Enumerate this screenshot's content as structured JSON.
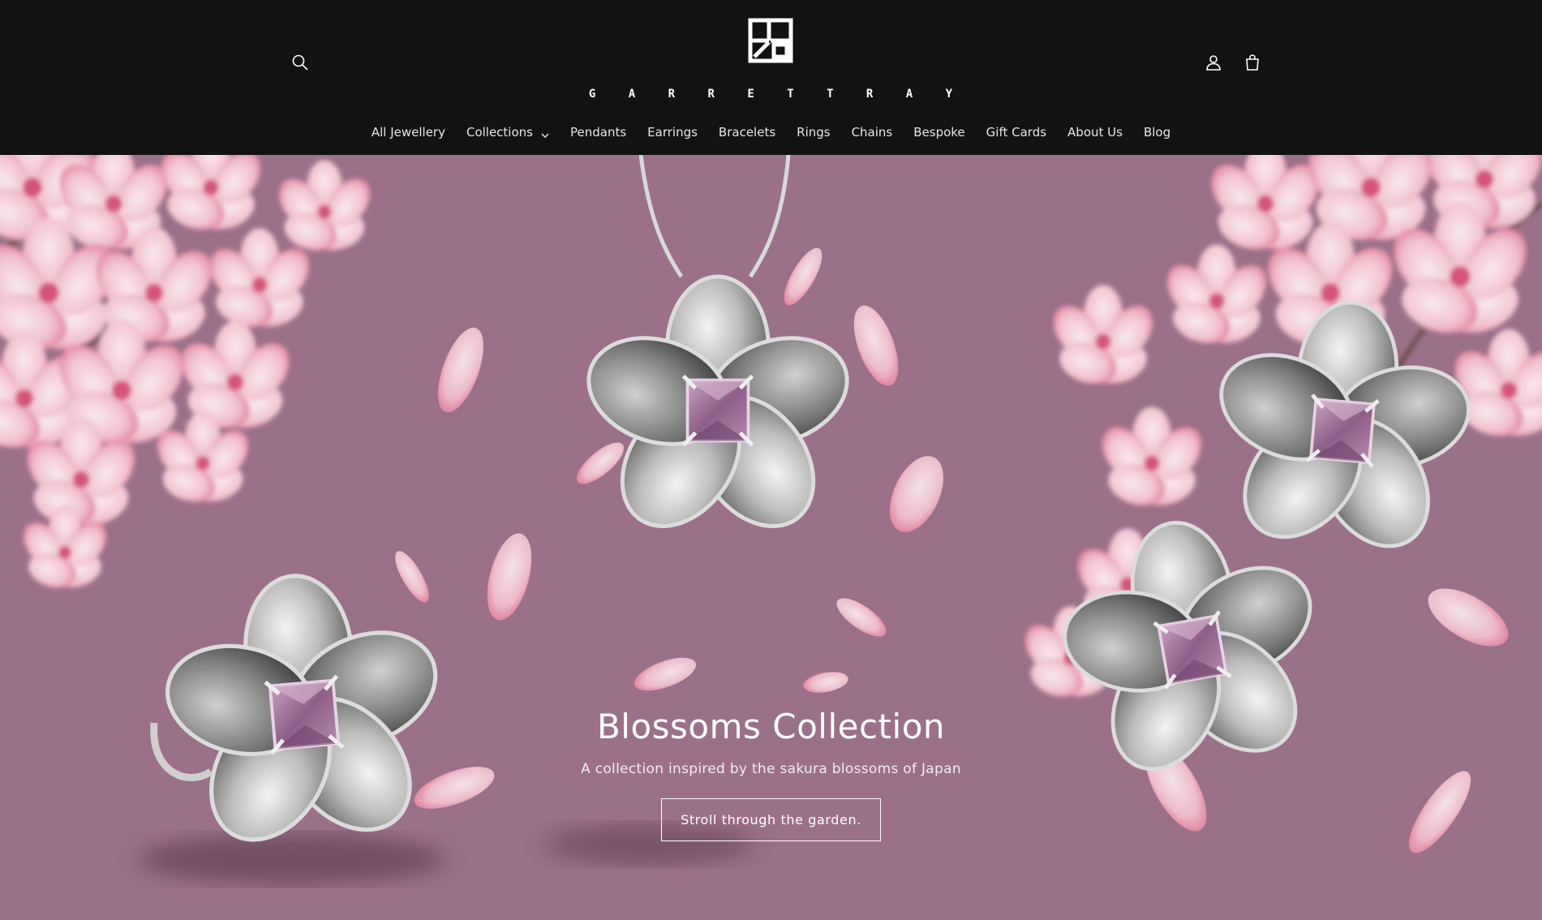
{
  "header": {
    "logo_text": "G A R R E T T   R A Y",
    "icons": {
      "search": "search-icon",
      "account": "user-icon",
      "cart": "cart-icon"
    }
  },
  "nav": {
    "items": [
      {
        "label": "All Jewellery"
      },
      {
        "label": "Collections",
        "has_dropdown": true
      },
      {
        "label": "Pendants"
      },
      {
        "label": "Earrings"
      },
      {
        "label": "Bracelets"
      },
      {
        "label": "Rings"
      },
      {
        "label": "Chains"
      },
      {
        "label": "Bespoke"
      },
      {
        "label": "Gift Cards"
      },
      {
        "label": "About Us"
      },
      {
        "label": "Blog"
      }
    ]
  },
  "hero": {
    "title": "Blossoms Collection",
    "subtitle": "A collection inspired by the sakura blossoms of Japan",
    "button_label": "Stroll through the garden.",
    "background_color": "#9b7189"
  },
  "colors": {
    "header_bg": "#121212",
    "accent_text": "#ffffff",
    "gem": "#a1789e"
  }
}
